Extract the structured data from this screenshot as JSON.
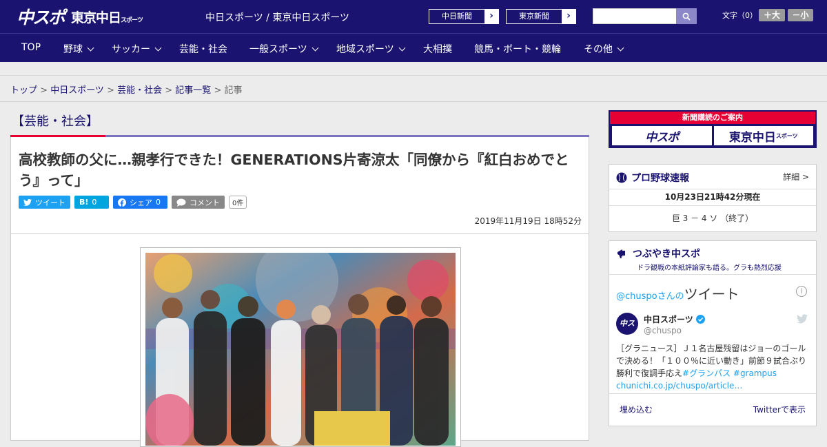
{
  "header": {
    "logo_main": "中スポ",
    "logo_tokyo": "東京中日",
    "logo_tokyo_suffix": "スポーツ",
    "site_title": "中日スポーツ / 東京中日スポーツ",
    "paper_links": [
      "中日新聞",
      "東京新聞"
    ],
    "search_placeholder": "",
    "font_size_label": "文字（0）",
    "font_bigger": "＋大",
    "font_smaller": "－小"
  },
  "nav": {
    "items": [
      {
        "label": "TOP",
        "dropdown": false
      },
      {
        "label": "野球",
        "dropdown": true
      },
      {
        "label": "サッカー",
        "dropdown": true
      },
      {
        "label": "芸能・社会",
        "dropdown": false
      },
      {
        "label": "一般スポーツ",
        "dropdown": true
      },
      {
        "label": "地域スポーツ",
        "dropdown": true
      },
      {
        "label": "大相撲",
        "dropdown": false
      },
      {
        "label": "競馬・ボート・競輪",
        "dropdown": false
      },
      {
        "label": "その他",
        "dropdown": true
      }
    ]
  },
  "breadcrumb": {
    "items": [
      "トップ",
      "中日スポーツ",
      "芸能・社会",
      "記事一覧"
    ],
    "current": "記事",
    "sep": " > "
  },
  "article": {
    "category": "【芸能・社会】",
    "headline": "高校教師の父に…親孝行できた！GENERATIONS片寄涼太「同僚から『紅白おめでとう』って」",
    "share": {
      "tweet": "ツイート",
      "hatena": "B!",
      "hatena_count": "0",
      "facebook": "シェア",
      "facebook_count": "0",
      "comment": "コメント",
      "comment_count": "0件"
    },
    "date": "2019年11月19日 18時52分"
  },
  "sidebar": {
    "subscribe": {
      "title": "新聞購読のご案内",
      "btn1": "中スポ",
      "btn2": "東京中日",
      "btn2_suffix": "スポーツ"
    },
    "baseball": {
      "title": "プロ野球速報",
      "more": "詳細 >",
      "time": "10月23日21時42分現在",
      "score": "巨 3 － 4 ソ （終了）"
    },
    "tweets": {
      "title": "つぶやき中スポ",
      "subtitle": "ドラ観戦の本紙評論家も語る。グラも熱烈応援",
      "user_prefix": "@chuspoさんの",
      "user_big": "ツイート",
      "name": "中日スポーツ",
      "handle": "@chuspo",
      "text": "［グラニュース］Ｊ１名古屋残留はジョーのゴールで決める！「１００％に近い動き」前節９試合ぶり勝利で復調手応え",
      "tags": "#グランパス #grampus",
      "link": "chunichi.co.jp/chuspo/article…",
      "embed": "埋め込む",
      "view_on": "Twitterで表示"
    }
  },
  "colors": {
    "brand": "#1a1470",
    "accent_red": "#e60033",
    "twitter": "#1da1f2",
    "facebook": "#1877f2"
  }
}
